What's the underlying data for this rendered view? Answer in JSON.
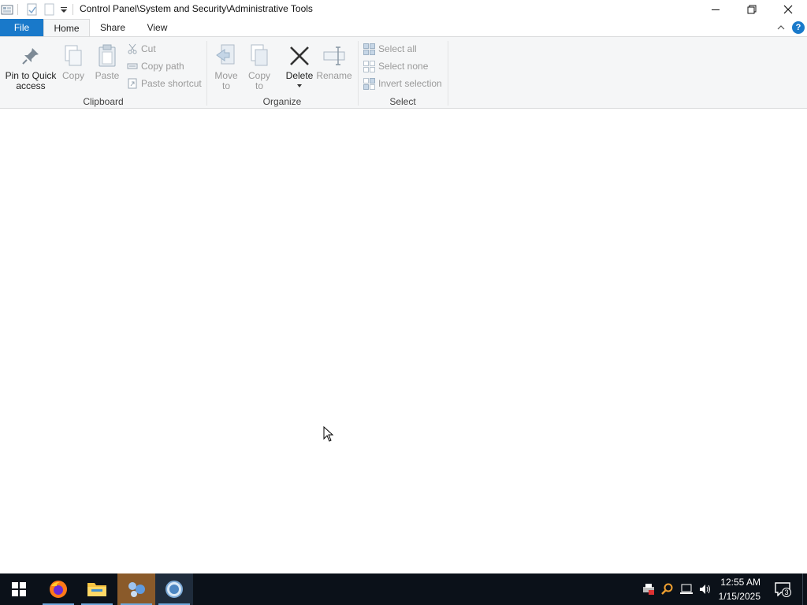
{
  "window": {
    "title": "Control Panel\\System and Security\\Administrative Tools"
  },
  "ribbon": {
    "tabs": {
      "file": "File",
      "home": "Home",
      "share": "Share",
      "view": "View"
    },
    "clipboard": {
      "pin_line1": "Pin to Quick",
      "pin_line2": "access",
      "copy": "Copy",
      "paste": "Paste",
      "cut": "Cut",
      "copy_path": "Copy path",
      "paste_shortcut": "Paste shortcut",
      "group_label": "Clipboard"
    },
    "organize": {
      "move_line1": "Move",
      "move_line2": "to",
      "copy_line1": "Copy",
      "copy_line2": "to",
      "delete": "Delete",
      "rename": "Rename",
      "group_label": "Organize"
    },
    "select": {
      "select_all": "Select all",
      "select_none": "Select none",
      "invert_selection": "Invert selection",
      "group_label": "Select"
    }
  },
  "taskbar": {
    "clock_time": "12:55 AM",
    "clock_date": "1/15/2025",
    "notification_count": "3"
  },
  "colors": {
    "file_tab": "#1979ca",
    "taskbar": "#0b1119",
    "help": "#1979ca"
  }
}
